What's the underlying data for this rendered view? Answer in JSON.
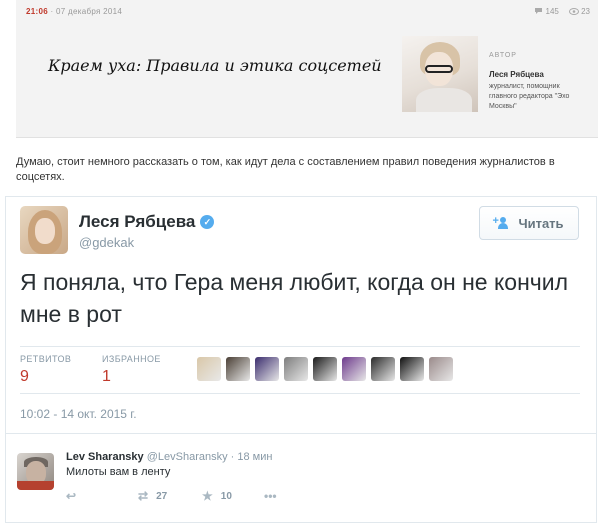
{
  "blog": {
    "time": "21:06",
    "date": "07 декабря 2014",
    "comments": "145",
    "views": "23",
    "title": "Краем уха: Правила и этика соцсетей",
    "author_label": "АВТОР",
    "author_name": "Леся Рябцева",
    "author_desc": "журналист, помощник главного редактора \"Эхо Москвы\""
  },
  "intro": "Думаю, стоит немного рассказать о том, как идут дела с составлением правил поведения журналистов в соцсетях.",
  "tweet": {
    "name": "Леся Рябцева",
    "handle": "@gdekak",
    "follow_label": "Читать",
    "text": "Я поняла, что Гера меня любит, когда он не кончил мне в рот",
    "retweets_label": "РЕТВИТОВ",
    "retweets": "9",
    "favorites_label": "ИЗБРАННОЕ",
    "favorites": "1",
    "date": "10:02 - 14 окт. 2015 г.",
    "faver_colors": [
      "#d9c7a8",
      "#4a3f35",
      "#3b2d6e",
      "#7d7d7d",
      "#1a1a1a",
      "#6d3a8c",
      "#2b2b2b",
      "#101010",
      "#9a8a8a"
    ]
  },
  "reply": {
    "name": "Lev Sharansky",
    "handle": "@LevSharansky",
    "time": "· 18 мин",
    "text": "Милоты вам в ленту",
    "retweets": "27",
    "favorites": "10"
  },
  "colors": {
    "accent": "#55acee",
    "stat_value": "#c0392b",
    "muted": "#8899a6"
  }
}
